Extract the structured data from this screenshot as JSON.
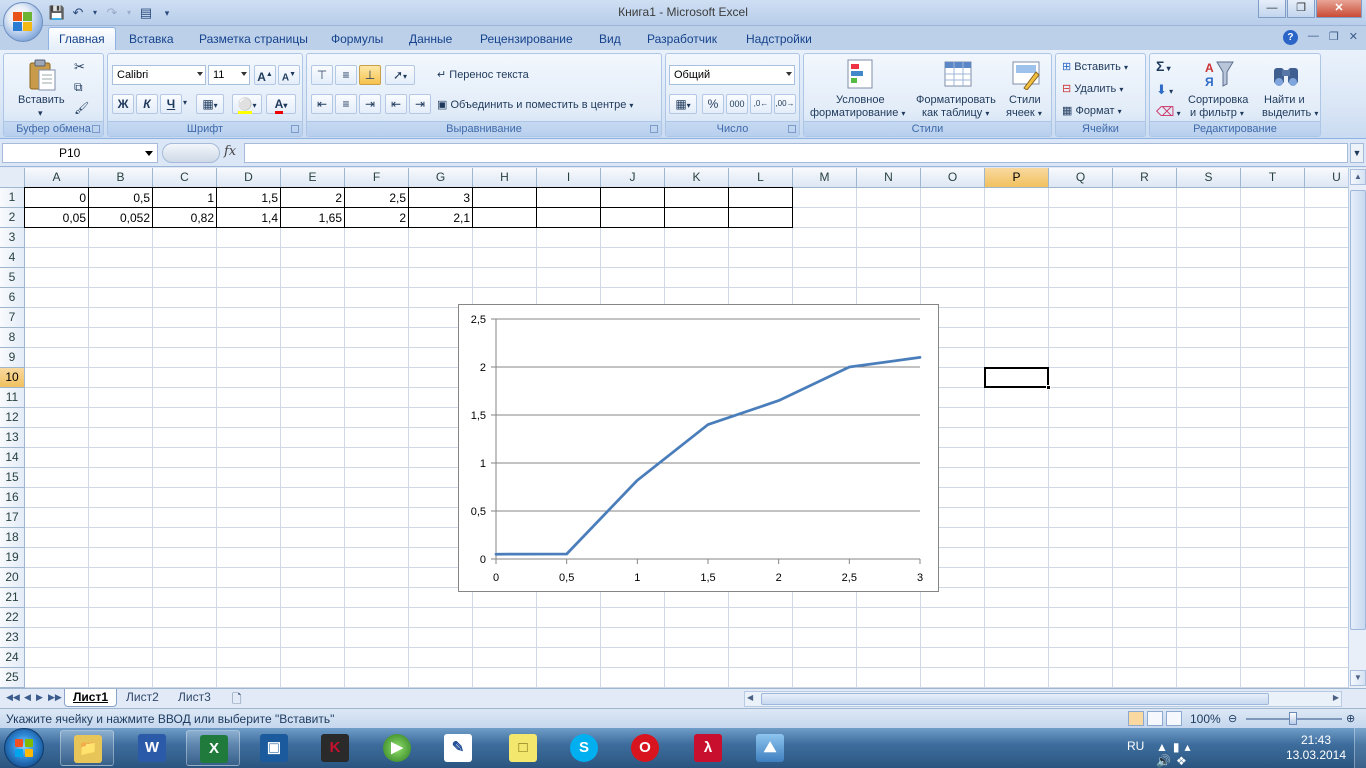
{
  "window": {
    "title": "Книга1 - Microsoft Excel"
  },
  "ribbon": {
    "tabs": [
      "Главная",
      "Вставка",
      "Разметка страницы",
      "Формулы",
      "Данные",
      "Рецензирование",
      "Вид",
      "Разработчик",
      "Надстройки"
    ],
    "active_tab": "Главная",
    "clipboard": {
      "paste": "Вставить",
      "label": "Буфер обмена"
    },
    "font": {
      "name": "Calibri",
      "size": "11",
      "bold": "Ж",
      "italic": "К",
      "underline": "Ч",
      "label": "Шрифт"
    },
    "alignment": {
      "wrap": "Перенос текста",
      "merge": "Объединить и поместить в центре",
      "label": "Выравнивание"
    },
    "number": {
      "format": "Общий",
      "label": "Число"
    },
    "styles": {
      "cond": "Условное\nформатирование",
      "cond1": "Условное",
      "cond2": "форматирование",
      "table1": "Форматировать",
      "table2": "как таблицу",
      "cell1": "Стили",
      "cell2": "ячеек",
      "label": "Стили"
    },
    "cells": {
      "insert": "Вставить",
      "delete": "Удалить",
      "format": "Формат",
      "label": "Ячейки"
    },
    "editing": {
      "sort1": "Сортировка",
      "sort2": "и фильтр",
      "find1": "Найти и",
      "find2": "выделить",
      "label": "Редактирование"
    }
  },
  "formula_bar": {
    "name_box": "P10",
    "fx": "fx",
    "formula": ""
  },
  "grid": {
    "columns": [
      "A",
      "B",
      "C",
      "D",
      "E",
      "F",
      "G",
      "H",
      "I",
      "J",
      "K",
      "L",
      "M",
      "N",
      "O",
      "P",
      "Q",
      "R",
      "S",
      "T",
      "U"
    ],
    "rows": [
      "1",
      "2",
      "3",
      "4",
      "5",
      "6",
      "7",
      "8",
      "9",
      "10",
      "11",
      "12",
      "13",
      "14",
      "15",
      "16",
      "17",
      "18",
      "19",
      "20",
      "21",
      "22",
      "23",
      "24",
      "25"
    ],
    "selected_column": "P",
    "selected_row": "10",
    "row1": [
      "0",
      "0,5",
      "1",
      "1,5",
      "2",
      "2,5",
      "3"
    ],
    "row2": [
      "0,05",
      "0,052",
      "0,82",
      "1,4",
      "1,65",
      "2",
      "2,1"
    ]
  },
  "chart_data": {
    "type": "line",
    "x": [
      0,
      0.5,
      1,
      1.5,
      2,
      2.5,
      3
    ],
    "series": [
      {
        "values": [
          0.05,
          0.052,
          0.82,
          1.4,
          1.65,
          2,
          2.1
        ]
      }
    ],
    "x_tick_labels": [
      "0",
      "0,5",
      "1",
      "1,5",
      "2",
      "2,5",
      "3"
    ],
    "y_tick_labels": [
      "0",
      "0,5",
      "1",
      "1,5",
      "2",
      "2,5"
    ],
    "ylim": [
      0,
      2.5
    ],
    "xlim": [
      0,
      3
    ],
    "grid": "horizontal major gridlines",
    "legend": "none",
    "line_color": "#4a7ebb"
  },
  "sheets": {
    "tabs": [
      "Лист1",
      "Лист2",
      "Лист3"
    ],
    "active": "Лист1"
  },
  "status": {
    "message": "Укажите ячейку и нажмите ВВОД или выберите \"Вставить\"",
    "zoom": "100%"
  },
  "taskbar": {
    "language": "RU",
    "time": "21:43",
    "date": "13.03.2014",
    "apps": [
      "explorer-icon",
      "word-icon",
      "excel-icon",
      "app-icon",
      "kaspersky-icon",
      "media-player-icon",
      "app-icon-2",
      "sticky-notes-icon",
      "skype-icon",
      "opera-icon",
      "acrobat-icon",
      "photo-viewer-icon"
    ]
  }
}
